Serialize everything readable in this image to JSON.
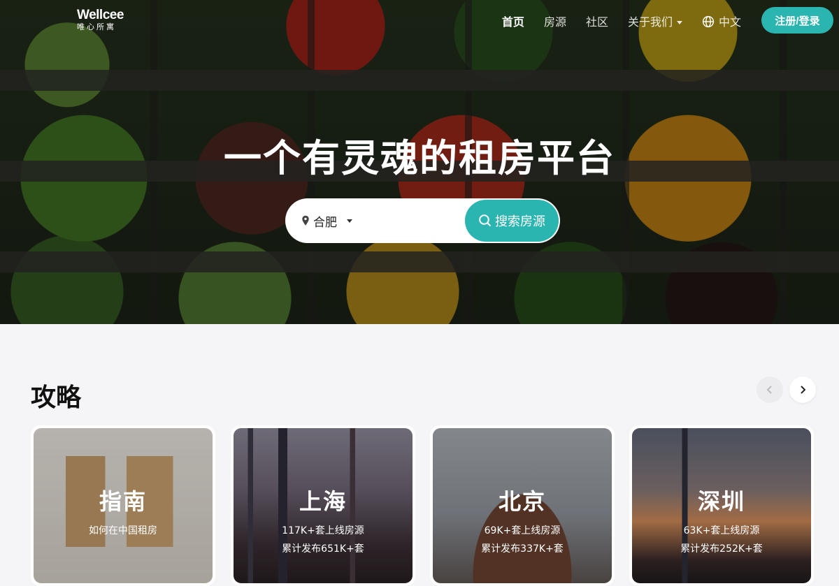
{
  "brand": {
    "name": "Wellcee",
    "name_cn": "唯心所寓"
  },
  "nav": {
    "items": [
      {
        "label": "首页",
        "active": true
      },
      {
        "label": "房源"
      },
      {
        "label": "社区"
      },
      {
        "label": "关于我们",
        "dropdown": true
      }
    ],
    "language": "中文",
    "login_label": "注册/登录"
  },
  "hero": {
    "title": "一个有灵魂的租房平台",
    "city": "合肥",
    "search_label": "搜索房源"
  },
  "section": {
    "title": "攻略",
    "cards": [
      {
        "title": "指南",
        "line1": "如何在中国租房",
        "line2": ""
      },
      {
        "title": "上海",
        "line1": "117K+套上线房源",
        "line2": "累计发布651K+套"
      },
      {
        "title": "北京",
        "line1": "69K+套上线房源",
        "line2": "累计发布337K+套"
      },
      {
        "title": "深圳",
        "line1": "63K+套上线房源",
        "line2": "累计发布252K+套"
      }
    ]
  },
  "colors": {
    "accent": "#2bb5b0"
  },
  "icons": [
    "location-pin-icon",
    "chevron-down-icon",
    "globe-icon",
    "search-icon",
    "chevron-left-icon",
    "chevron-right-icon"
  ]
}
